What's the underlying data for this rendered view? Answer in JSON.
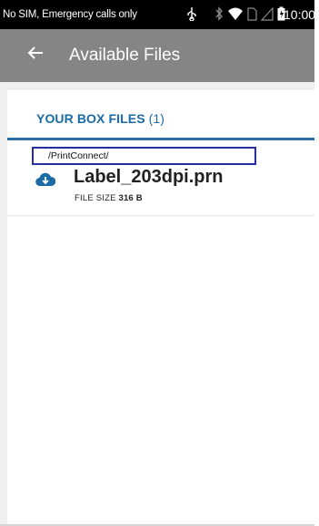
{
  "status_bar": {
    "carrier_text": "No SIM, Emergency calls only",
    "time": "10:00",
    "icons": [
      "usb-icon",
      "bluetooth-icon",
      "wifi-icon",
      "sim-icon",
      "signal-icon",
      "battery-icon"
    ]
  },
  "app_bar": {
    "title": "Available Files",
    "back_icon": "arrow-left-icon"
  },
  "section": {
    "title": "YOUR BOX FILES",
    "count": "(1)"
  },
  "files": [
    {
      "path": "/PrintConnect/",
      "name": "Label_203dpi.prn",
      "size_label": "FILE SIZE",
      "size_value": "316 B",
      "icon": "cloud-download-icon"
    }
  ],
  "colors": {
    "app_bar": "#858585",
    "accent": "#1a6aa6",
    "path_border": "#2430a0"
  }
}
